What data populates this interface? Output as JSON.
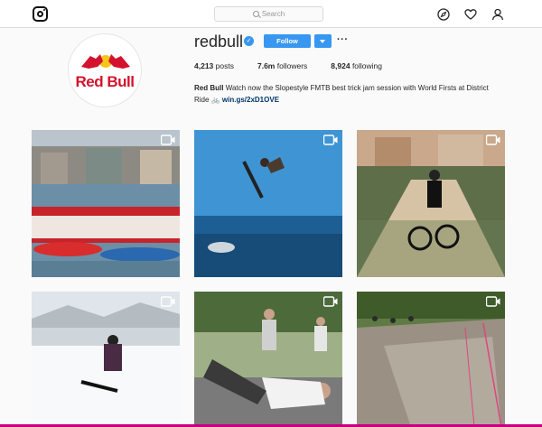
{
  "nav": {
    "search_placeholder": "Search",
    "icons": [
      "instagram-logo-icon",
      "compass-icon",
      "heart-icon",
      "person-icon"
    ]
  },
  "profile": {
    "username": "redbull",
    "verified": true,
    "follow_label": "Follow",
    "more_label": "···",
    "logo_text": "Red Bull",
    "stats": {
      "posts_value": "4,213",
      "posts_label": "posts",
      "followers_value": "7.6m",
      "followers_label": "followers",
      "following_value": "8,924",
      "following_label": "following"
    },
    "bio": {
      "name": "Red Bull",
      "text": "Watch now the Slopestyle FMTB best trick jam session with World Firsts at District Ride",
      "link": "win.gs/2xD1OVE"
    }
  },
  "posts": [
    {
      "type": "video",
      "subject": "boats-crowd"
    },
    {
      "type": "video",
      "subject": "bike-sky-jump"
    },
    {
      "type": "video",
      "subject": "mtb-ramp-crowd"
    },
    {
      "type": "video",
      "subject": "snowboard"
    },
    {
      "type": "video",
      "subject": "breakdance"
    },
    {
      "type": "video",
      "subject": "downhill-track"
    }
  ],
  "colors": {
    "accent": "#3897f0",
    "brand_red": "#d3132e",
    "link": "#003569"
  }
}
